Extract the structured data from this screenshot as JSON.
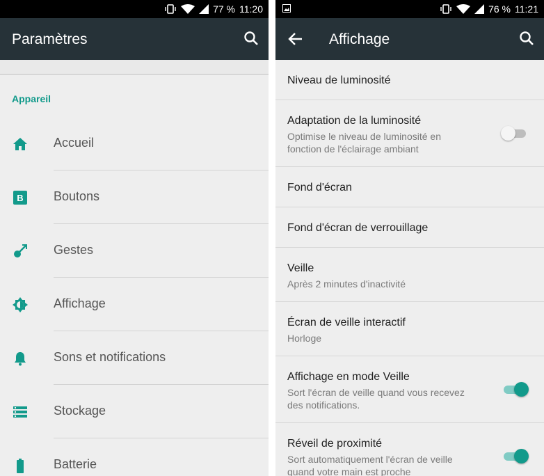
{
  "left": {
    "status": {
      "battery": "77 %",
      "time": "11:20"
    },
    "title": "Paramètres",
    "section": "Appareil",
    "items": [
      {
        "label": "Accueil",
        "icon": "home-icon"
      },
      {
        "label": "Boutons",
        "icon": "b-icon"
      },
      {
        "label": "Gestes",
        "icon": "gesture-icon"
      },
      {
        "label": "Affichage",
        "icon": "brightness-icon"
      },
      {
        "label": "Sons et notifications",
        "icon": "bell-icon"
      },
      {
        "label": "Stockage",
        "icon": "storage-icon"
      },
      {
        "label": "Batterie",
        "icon": "battery-icon"
      }
    ]
  },
  "right": {
    "status": {
      "battery": "76 %",
      "time": "11:21"
    },
    "title": "Affichage",
    "rows": [
      {
        "title": "Niveau de luminosité"
      },
      {
        "title": "Adaptation de la luminosité",
        "subtitle": "Optimise le niveau de luminosité en fonction de l'éclairage ambiant",
        "toggle": "off"
      },
      {
        "title": "Fond d'écran"
      },
      {
        "title": "Fond d'écran de verrouillage"
      },
      {
        "title": "Veille",
        "subtitle": "Après 2 minutes d'inactivité"
      },
      {
        "title": "Écran de veille interactif",
        "subtitle": "Horloge"
      },
      {
        "title": "Affichage en mode Veille",
        "subtitle": "Sort l'écran de veille quand vous recevez des notifications.",
        "toggle": "on"
      },
      {
        "title": "Réveil de proximité",
        "subtitle": "Sort automatiquement l'écran de veille quand votre main est proche",
        "toggle": "on"
      }
    ]
  },
  "colors": {
    "accent": "#129a8b",
    "appbar": "#263238",
    "background": "#eeeeee"
  }
}
